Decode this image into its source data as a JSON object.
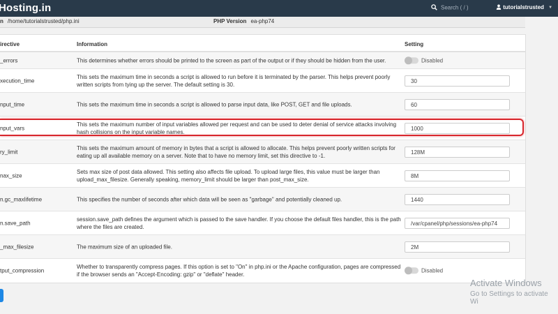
{
  "topbar": {
    "brand": "Hosting.in",
    "search_placeholder": "Search ( / )",
    "user": "tutorialstrusted"
  },
  "infobar": {
    "path_label": "n",
    "path_value": "/home/tutorialstrusted/php.ini",
    "php_label": "PHP Version",
    "php_value": "ea-php74"
  },
  "table": {
    "headers": {
      "directive": "irective",
      "information": "Information",
      "setting": "Setting"
    },
    "rows": [
      {
        "directive": "_errors",
        "info": "This determines whether errors should be printed to the screen as part of the output or if they should be hidden from the user.",
        "type": "toggle",
        "value": "Disabled"
      },
      {
        "directive": "xecution_time",
        "info": "This sets the maximum time in seconds a script is allowed to run before it is terminated by the parser. This helps prevent poorly written scripts from tying up the server. The default setting is 30.",
        "type": "input",
        "value": "30"
      },
      {
        "directive": "nput_time",
        "info": "This sets the maximum time in seconds a script is allowed to parse input data, like POST, GET and file uploads.",
        "type": "input",
        "value": "60"
      },
      {
        "directive": "nput_vars",
        "info": "This sets the maximum number of input variables allowed per request and can be used to deter denial of service attacks involving hash collisions on the input variable names.",
        "type": "input",
        "value": "1000"
      },
      {
        "directive": "ry_limit",
        "info": "This sets the maximum amount of memory in bytes that a script is allowed to allocate. This helps prevent poorly written scripts for eating up all available memory on a server. Note that to have no memory limit, set this directive to -1.",
        "type": "input",
        "value": "128M"
      },
      {
        "directive": "nax_size",
        "info": "Sets max size of post data allowed. This setting also affects file upload. To upload large files, this value must be larger than upload_max_filesize. Generally speaking, memory_limit should be larger than post_max_size.",
        "type": "input",
        "value": "8M"
      },
      {
        "directive": "n.gc_maxlifetime",
        "info": "This specifies the number of seconds after which data will be seen as \"garbage\" and potentially cleaned up.",
        "type": "input",
        "value": "1440"
      },
      {
        "directive": "n.save_path",
        "info": "session.save_path defines the argument which is passed to the save handler. If you choose the default files handler, this is the path where the files are created.",
        "type": "input",
        "value": "/var/cpanel/php/sessions/ea-php74"
      },
      {
        "directive": "_max_filesize",
        "info": "The maximum size of an uploaded file.",
        "type": "input",
        "value": "2M"
      },
      {
        "directive": "tput_compression",
        "info": "Whether to transparently compress pages. If this option is set to \"On\" in php.ini or the Apache configuration, pages are compressed if the browser sends an \"Accept-Encoding: gzip\" or \"deflate\" header.",
        "type": "toggle",
        "value": "Disabled"
      }
    ]
  },
  "watermark": {
    "line1": "Activate Windows",
    "line2": "Go to Settings to activate Wi"
  },
  "colors": {
    "topbar": "#293a4a",
    "highlight": "#d8262c",
    "button": "#1e88e5"
  }
}
